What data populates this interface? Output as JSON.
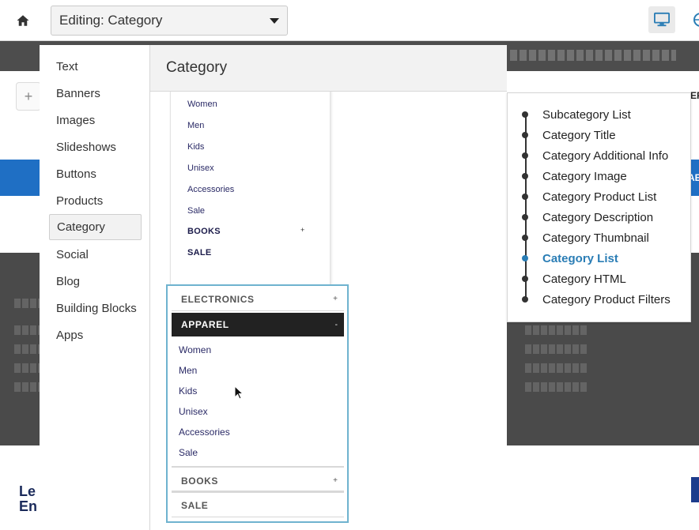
{
  "topbar": {
    "editing_label": "Editing: Category",
    "home_icon": "home-icon",
    "device_icon": "desktop-icon",
    "globe_icon": "globe-icon"
  },
  "background": {
    "cut_text": "ER",
    "blue_cut": "AE",
    "logo_text": "Le\nEn",
    "plus_glyph": "+"
  },
  "side_menu": {
    "items": [
      {
        "label": "Text"
      },
      {
        "label": "Banners"
      },
      {
        "label": "Images"
      },
      {
        "label": "Slideshows"
      },
      {
        "label": "Buttons"
      },
      {
        "label": "Products"
      },
      {
        "label": "Category",
        "active": true
      },
      {
        "label": "Social"
      },
      {
        "label": "Blog"
      },
      {
        "label": "Building Blocks"
      },
      {
        "label": "Apps"
      }
    ]
  },
  "panel": {
    "title": "Category"
  },
  "preview1": {
    "items": [
      "Women",
      "Men",
      "Kids",
      "Unisex",
      "Accessories",
      "Sale"
    ],
    "books": "BOOKS",
    "books_sign": "+",
    "sale": "SALE"
  },
  "preview2": {
    "electronics": "ELECTRONICS",
    "electronics_sign": "+",
    "apparel": "APPAREL",
    "apparel_sign": "-",
    "items": [
      "Women",
      "Men",
      "Kids",
      "Unisex",
      "Accessories",
      "Sale"
    ],
    "books": "BOOKS",
    "books_sign": "+",
    "sale": "SALE"
  },
  "layout_list": {
    "items": [
      {
        "label": "Subcategory List"
      },
      {
        "label": "Category Title"
      },
      {
        "label": "Category Additional Info"
      },
      {
        "label": "Category Image"
      },
      {
        "label": "Category Product List"
      },
      {
        "label": "Category Description"
      },
      {
        "label": "Category Thumbnail"
      },
      {
        "label": "Category List",
        "active": true
      },
      {
        "label": "Category HTML"
      },
      {
        "label": "Category Product Filters"
      }
    ],
    "accent_color": "#2a7db5"
  }
}
